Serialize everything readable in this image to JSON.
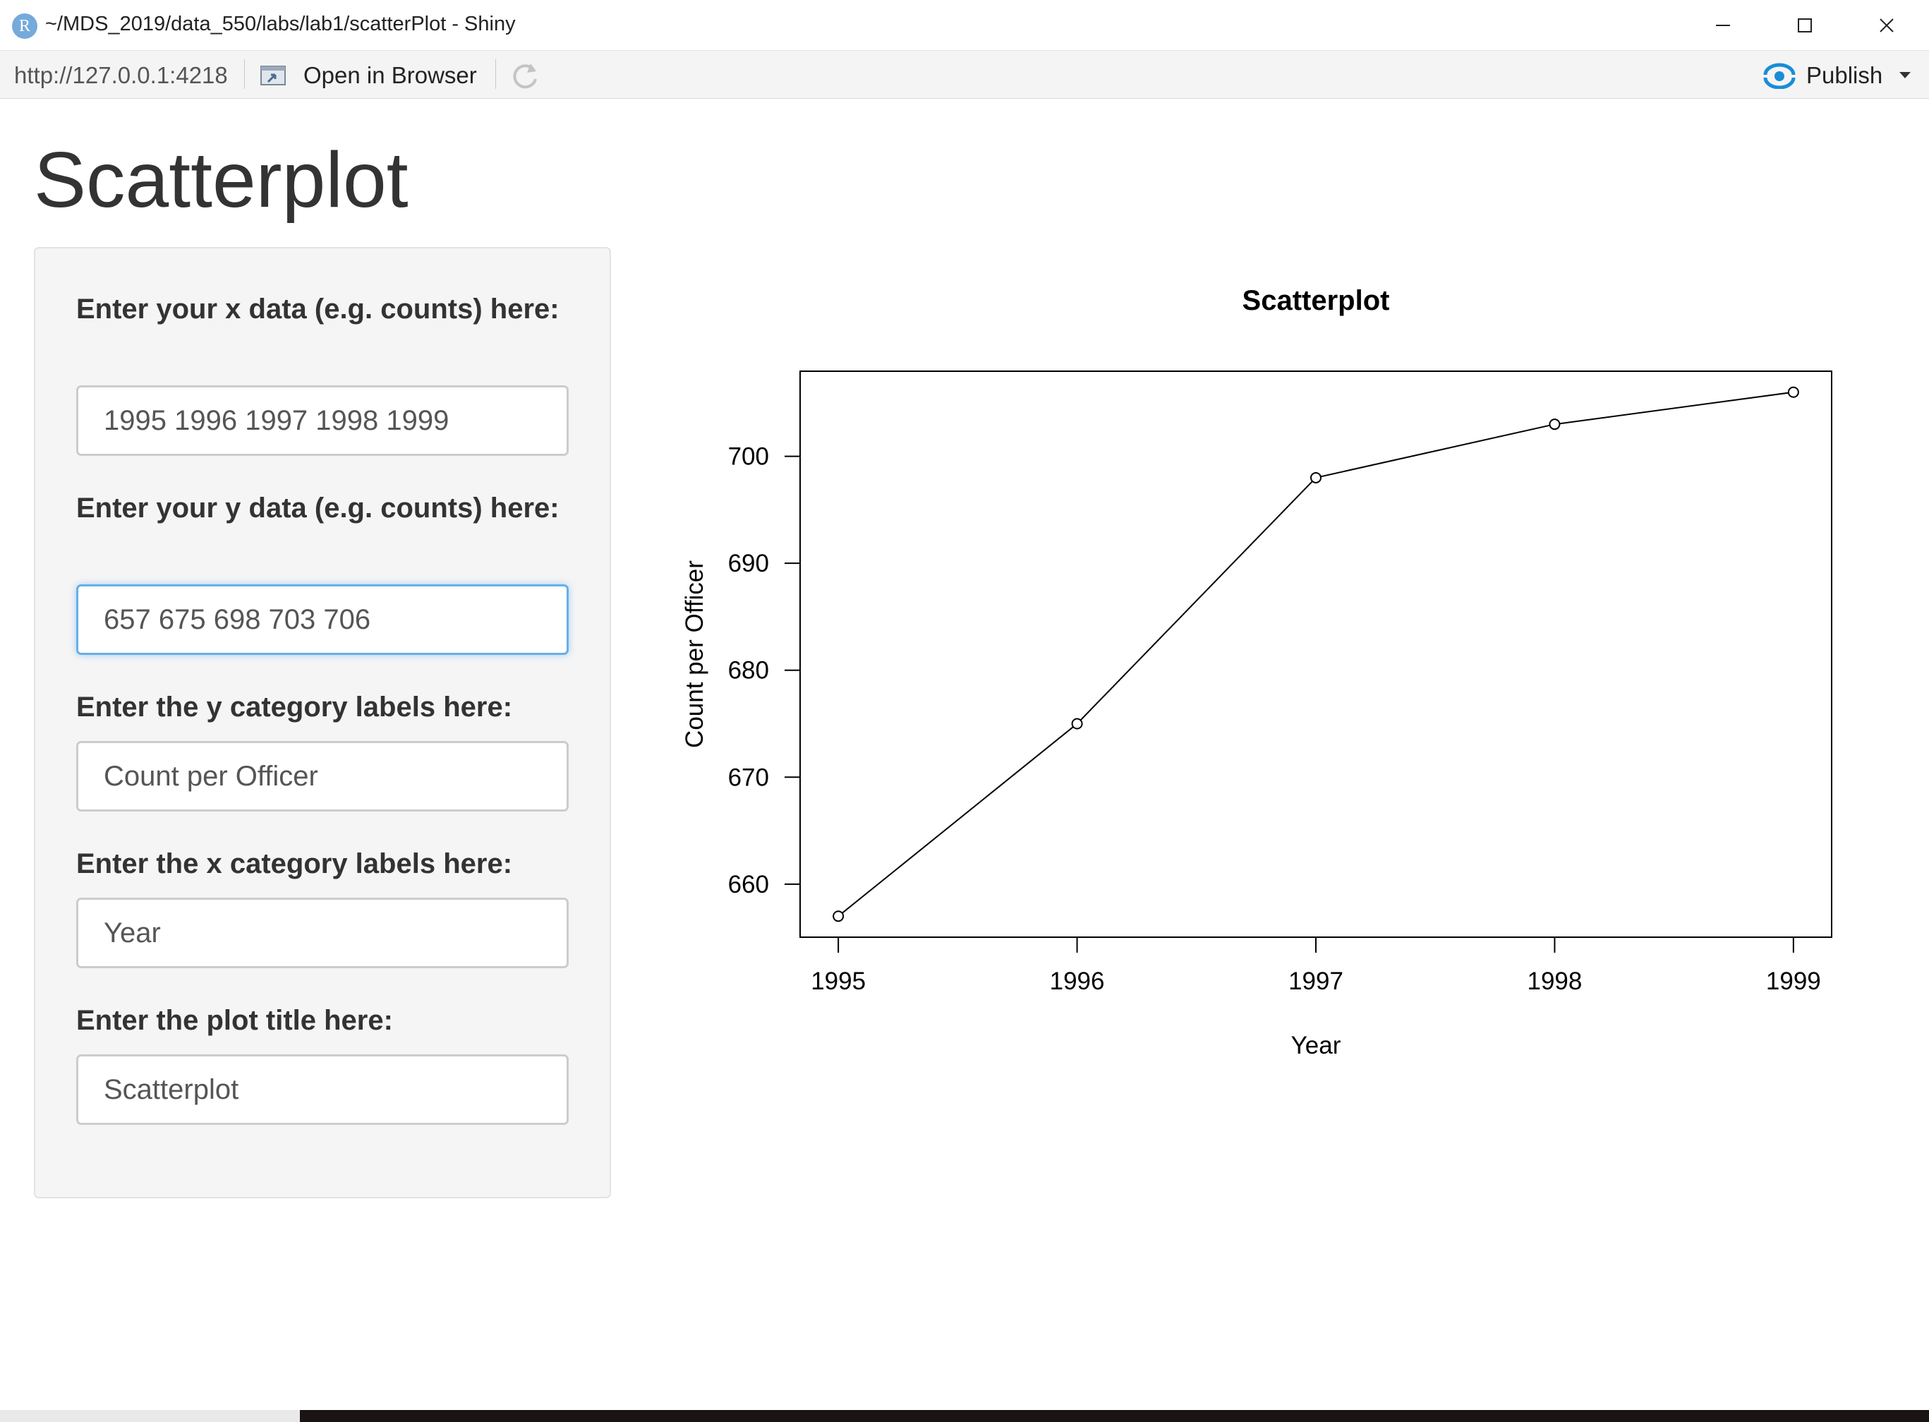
{
  "window": {
    "title": "~/MDS_2019/data_550/labs/lab1/scatterPlot - Shiny",
    "icon": "r-logo-icon"
  },
  "toolbar": {
    "url": "http://127.0.0.1:4218",
    "open_in_browser_label": "Open in Browser",
    "publish_label": "Publish",
    "accent_color": "#1a8cd8"
  },
  "page": {
    "title": "Scatterplot"
  },
  "inputs": {
    "x_data": {
      "label": "Enter your x data (e.g. counts) here:",
      "value": "1995 1996 1997 1998 1999"
    },
    "y_data": {
      "label": "Enter your y data (e.g. counts) here:",
      "value": "657 675 698 703 706"
    },
    "y_label": {
      "label": "Enter the y category labels here:",
      "value": "Count per Officer"
    },
    "x_label": {
      "label": "Enter the x category labels here:",
      "value": "Year"
    },
    "plot_title": {
      "label": "Enter the plot title here:",
      "value": "Scatterplot"
    }
  },
  "chart_data": {
    "type": "line",
    "title": "Scatterplot",
    "xlabel": "Year",
    "ylabel": "Count per Officer",
    "x": [
      1995,
      1996,
      1997,
      1998,
      1999
    ],
    "y": [
      657,
      675,
      698,
      703,
      706
    ],
    "xticks": [
      1995,
      1996,
      1997,
      1998,
      1999
    ],
    "yticks": [
      660,
      670,
      680,
      690,
      700
    ],
    "xlim": [
      1994.84,
      1999.16
    ],
    "ylim": [
      655.04,
      707.96
    ],
    "markers": "open-circle",
    "grid": false
  }
}
